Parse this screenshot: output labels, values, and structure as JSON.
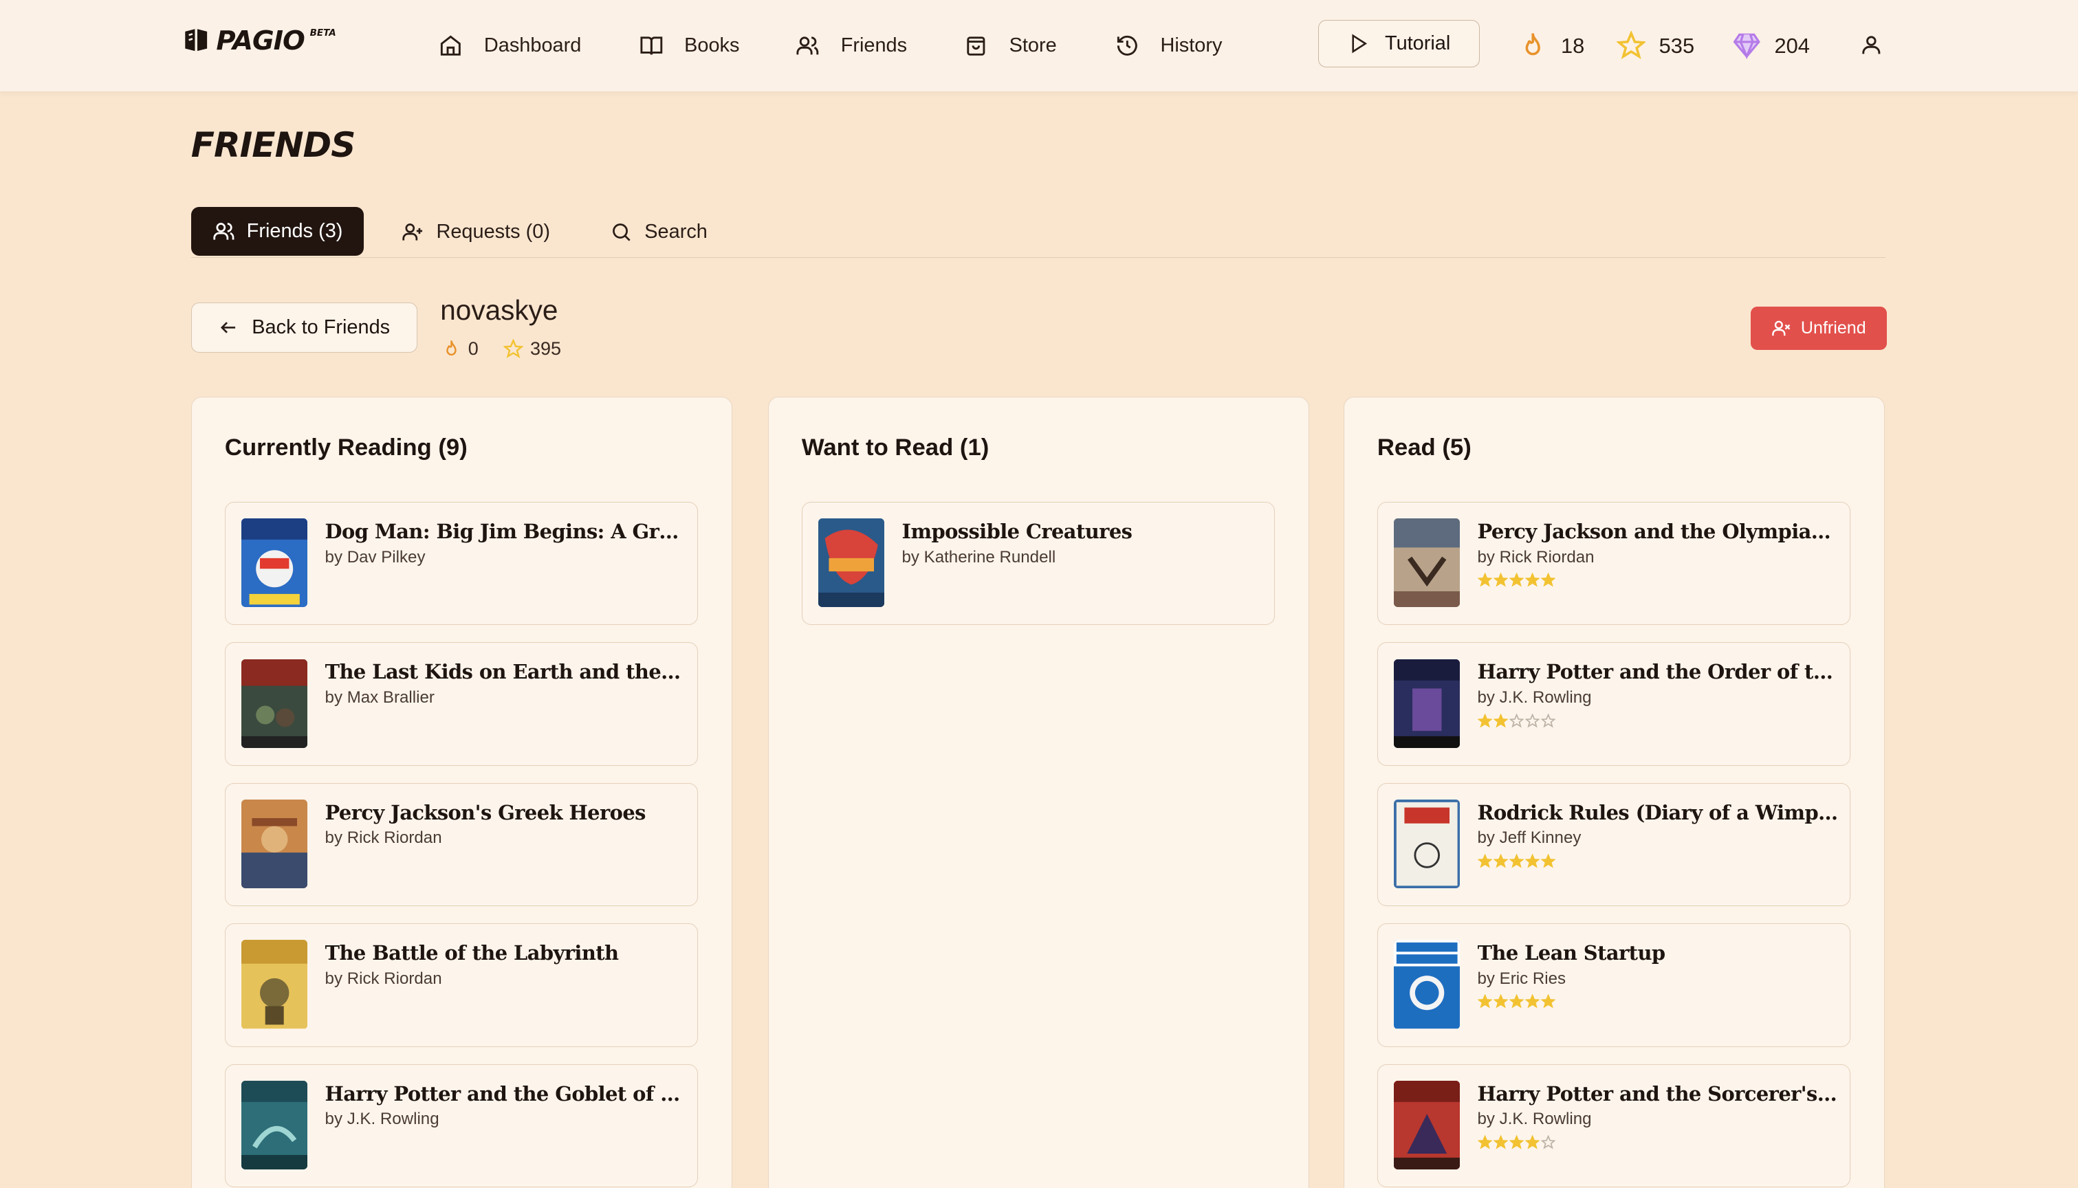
{
  "app": {
    "logo": "PAGIO",
    "logo_badge": "BETA"
  },
  "nav": [
    {
      "label": "Dashboard",
      "icon": "home-icon"
    },
    {
      "label": "Books",
      "icon": "book-open-icon"
    },
    {
      "label": "Friends",
      "icon": "users-icon"
    },
    {
      "label": "Store",
      "icon": "shopping-bag-icon"
    },
    {
      "label": "History",
      "icon": "history-icon"
    }
  ],
  "tutorial_label": "Tutorial",
  "user_stats": {
    "streak": "18",
    "stars": "535",
    "gems": "204"
  },
  "page_title": "FRIENDS",
  "tabs": [
    {
      "label": "Friends (3)",
      "active": true
    },
    {
      "label": "Requests (0)",
      "active": false
    },
    {
      "label": "Search",
      "active": false
    }
  ],
  "profile": {
    "back_label": "Back to Friends",
    "name": "novaskye",
    "streak": "0",
    "stars": "395",
    "unfriend_label": "Unfriend"
  },
  "colors": {
    "accent_dark": "#221510",
    "danger": "#e2504b",
    "star": "#f2c232",
    "flame": "#e8922b",
    "gem": "#b57be8"
  },
  "columns": [
    {
      "title": "Currently Reading (9)",
      "books": [
        {
          "title": "Dog Man: Big Jim Begins: A Graphic...",
          "author": "by Dav Pilkey"
        },
        {
          "title": "The Last Kids on Earth and the Skel...",
          "author": "by Max Brallier"
        },
        {
          "title": "Percy Jackson's Greek Heroes",
          "author": "by Rick Riordan"
        },
        {
          "title": "The Battle of the Labyrinth",
          "author": "by Rick Riordan"
        },
        {
          "title": "Harry Potter and the Goblet of Fire",
          "author": "by J.K. Rowling"
        }
      ]
    },
    {
      "title": "Want to Read (1)",
      "books": [
        {
          "title": "Impossible Creatures",
          "author": "by Katherine Rundell"
        }
      ]
    },
    {
      "title": "Read (5)",
      "books": [
        {
          "title": "Percy Jackson and the Olympians, B...",
          "author": "by Rick Riordan",
          "rating": 5
        },
        {
          "title": "Harry Potter and the Order of the P...",
          "author": "by J.K. Rowling",
          "rating": 2
        },
        {
          "title": "Rodrick Rules (Diary of a Wimpy Ki...",
          "author": "by Jeff Kinney",
          "rating": 5
        },
        {
          "title": "The Lean Startup",
          "author": "by Eric Ries",
          "rating": 5
        },
        {
          "title": "Harry Potter and the Sorcerer's Stone",
          "author": "by J.K. Rowling",
          "rating": 4
        }
      ]
    }
  ]
}
